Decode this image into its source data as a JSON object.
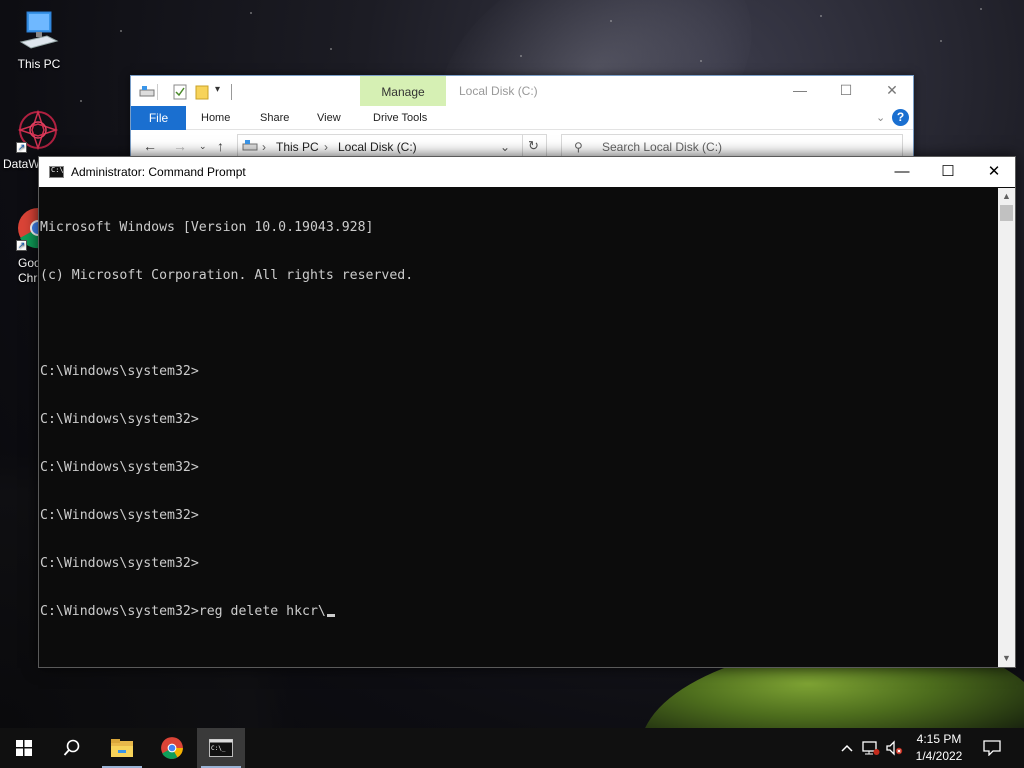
{
  "desktop": {
    "icons": [
      {
        "label": "This PC"
      },
      {
        "label": "DataW"
      },
      {
        "label": "Goo\nChr"
      }
    ]
  },
  "explorer": {
    "title": "Local Disk (C:)",
    "manage_tab": "Manage",
    "ribbon_tabs": {
      "file": "File",
      "home": "Home",
      "share": "Share",
      "view": "View",
      "drive_tools": "Drive Tools"
    },
    "address": {
      "segment_1": "This PC",
      "segment_2": "Local Disk (C:)"
    },
    "search_placeholder": "Search Local Disk (C:)"
  },
  "cmd": {
    "title": "Administrator: Command Prompt",
    "lines": [
      "Microsoft Windows [Version 10.0.19043.928]",
      "(c) Microsoft Corporation. All rights reserved.",
      "",
      "C:\\Windows\\system32>",
      "C:\\Windows\\system32>",
      "C:\\Windows\\system32>",
      "C:\\Windows\\system32>",
      "C:\\Windows\\system32>"
    ],
    "current_prompt": "C:\\Windows\\system32>",
    "current_input": "reg delete hkcr\\"
  },
  "taskbar": {
    "clock_time": "4:15 PM",
    "clock_date": "1/4/2022"
  }
}
